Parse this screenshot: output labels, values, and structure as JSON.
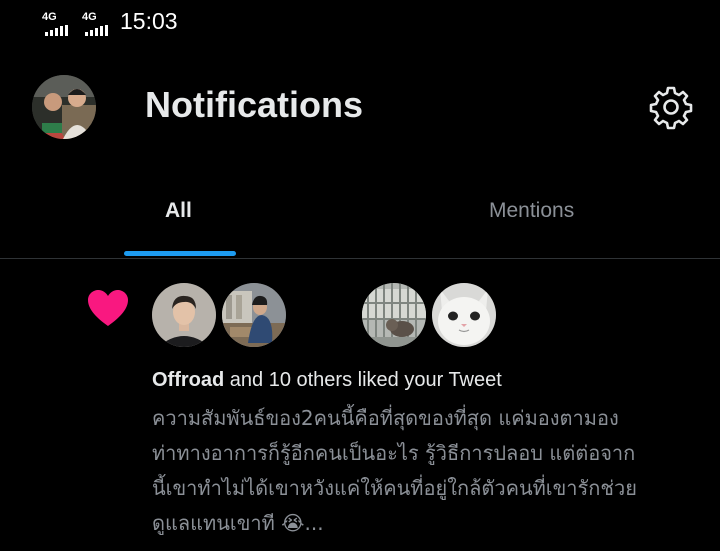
{
  "status_bar": {
    "network_1": "4G",
    "network_2": "4G",
    "time": "15:03",
    "icons": [
      "signal-bars-icon",
      "moon-icon",
      "wifi-icon",
      "battery-icon"
    ]
  },
  "header": {
    "title": "Notifications",
    "settings_icon": "gear-icon"
  },
  "tabs": [
    {
      "label": "All",
      "active": true
    },
    {
      "label": "Mentions",
      "active": false
    }
  ],
  "colors": {
    "background": "#000000",
    "text_primary": "#e7e9ea",
    "text_secondary": "#8b9097",
    "accent": "#1d9bf0",
    "like": "#f91880",
    "divider": "#2f3336"
  },
  "notification": {
    "type_icon": "heart-icon",
    "actor": "Offroad",
    "action": " and 10 others liked your Tweet",
    "tweet_text": "ความสัมพันธ์ของ2คนนี้คือที่สุดของที่สุด แค่มองตามอง\nท่าทางอาการก็รู้อีกคนเป็นอะไร รู้วิธีการปลอบ แต่ต่อจาก\nนี้เขาทำไม่ได้เขาหวังแค่ให้คนที่อยู่ใกล้ตัวคนที่เขารักช่วย\nดูแลแทนเขาที 😭...",
    "liker_avatars": [
      "avatar-man-portrait",
      "avatar-person-room",
      "avatar-cat-in-cage",
      "avatar-white-cat"
    ]
  }
}
